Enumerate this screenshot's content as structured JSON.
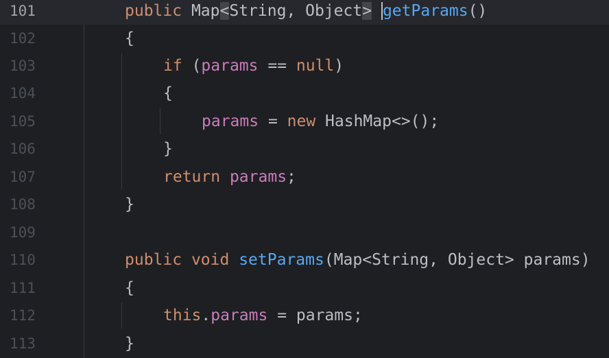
{
  "editor": {
    "line_numbers": [
      "101",
      "102",
      "103",
      "104",
      "105",
      "106",
      "107",
      "108",
      "109",
      "110",
      "111",
      "112",
      "113"
    ],
    "current_line": "101",
    "tokens": {
      "l101": {
        "public": "public",
        "map": "Map",
        "lt": "<",
        "string": "String, Object",
        "gt": ">",
        "method": "getParams",
        "parens": "()"
      },
      "l102": {
        "brace": "{"
      },
      "l103": {
        "if": "if",
        "open": " (",
        "params": "params",
        "rest": " == ",
        "null": "null",
        "close": ")"
      },
      "l104": {
        "brace": "{"
      },
      "l105": {
        "params": "params",
        "eq": " = ",
        "new": "new",
        "rest": " HashMap<>();"
      },
      "l106": {
        "brace": "}"
      },
      "l107": {
        "return": "return",
        "space": " ",
        "params": "params",
        "semi": ";"
      },
      "l108": {
        "brace": "}"
      },
      "l110": {
        "public": "public",
        "void": "void",
        "method": "setParams",
        "args": "(Map<String, Object> params)"
      },
      "l111": {
        "brace": "{"
      },
      "l112": {
        "this": "this",
        "dot": ".",
        "params": "params",
        "rest": " = params;"
      },
      "l113": {
        "brace": "}"
      }
    }
  },
  "colors": {
    "background": "#1e1f22",
    "keyword": "#cf8e6d",
    "method": "#56a8f5",
    "field": "#c77dbb",
    "text": "#bcbec4"
  }
}
